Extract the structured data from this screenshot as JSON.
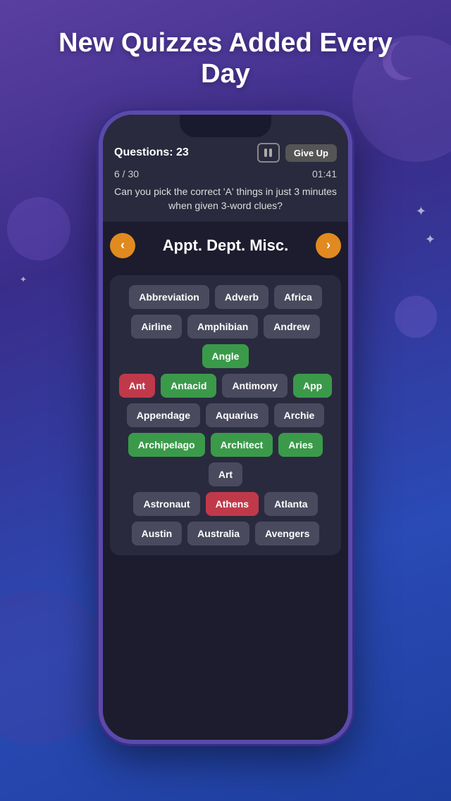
{
  "page": {
    "header": {
      "title": "New Quizzes Added Every Day"
    }
  },
  "quiz": {
    "questions_label": "Questions: 23",
    "progress": "6 / 30",
    "timer": "01:41",
    "question_text": "Can you pick the correct 'A' things in just 3 minutes when given 3-word clues?",
    "clue": "Appt. Dept. Misc.",
    "give_up_label": "Give Up",
    "pause_label": "pause"
  },
  "answers": [
    [
      {
        "label": "Abbreviation",
        "state": "default"
      },
      {
        "label": "Adverb",
        "state": "default"
      },
      {
        "label": "Africa",
        "state": "default"
      }
    ],
    [
      {
        "label": "Airline",
        "state": "default"
      },
      {
        "label": "Amphibian",
        "state": "default"
      },
      {
        "label": "Andrew",
        "state": "default"
      },
      {
        "label": "Angle",
        "state": "green"
      }
    ],
    [
      {
        "label": "Ant",
        "state": "red"
      },
      {
        "label": "Antacid",
        "state": "green"
      },
      {
        "label": "Antimony",
        "state": "default"
      },
      {
        "label": "App",
        "state": "green"
      }
    ],
    [
      {
        "label": "Appendage",
        "state": "default"
      },
      {
        "label": "Aquarius",
        "state": "default"
      },
      {
        "label": "Archie",
        "state": "default"
      }
    ],
    [
      {
        "label": "Archipelago",
        "state": "green"
      },
      {
        "label": "Architect",
        "state": "green"
      },
      {
        "label": "Aries",
        "state": "green"
      },
      {
        "label": "Art",
        "state": "default"
      }
    ],
    [
      {
        "label": "Astronaut",
        "state": "default"
      },
      {
        "label": "Athens",
        "state": "red"
      },
      {
        "label": "Atlanta",
        "state": "default"
      }
    ],
    [
      {
        "label": "Austin",
        "state": "default"
      },
      {
        "label": "Australia",
        "state": "default"
      },
      {
        "label": "Avengers",
        "state": "default"
      }
    ]
  ]
}
